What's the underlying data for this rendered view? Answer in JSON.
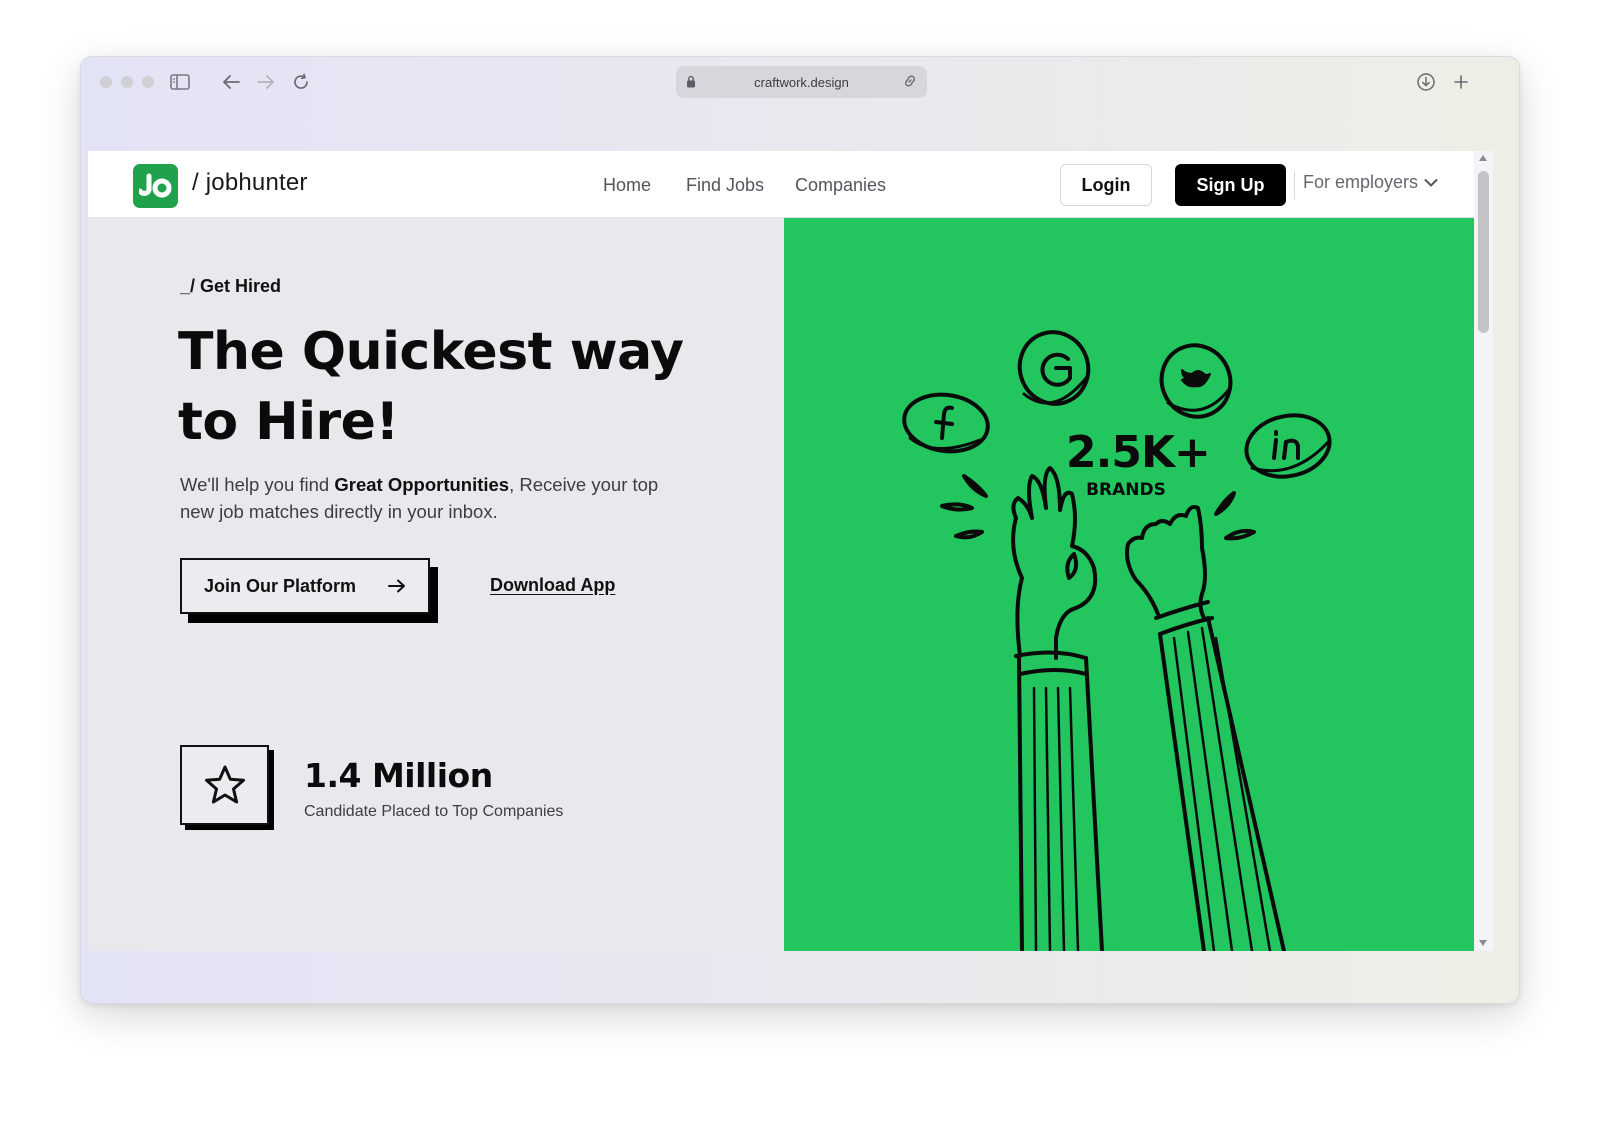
{
  "browser": {
    "url": "craftwork.design"
  },
  "nav": {
    "logo_mark": "Jo",
    "logo_text": "/ jobhunter",
    "links": [
      "Home",
      "Find Jobs",
      "Companies"
    ],
    "login_label": "Login",
    "signup_label": "Sign Up",
    "employers_label": "For employers"
  },
  "hero": {
    "eyebrow": "_/ Get Hired",
    "headline_line1": "The Quickest way",
    "headline_line2": "to Hire!",
    "sub_prefix": "We'll help you find ",
    "sub_bold": "Great Opportunities",
    "sub_suffix": ", Receive your top new job matches directly in your inbox.",
    "cta_label": "Join Our Platform",
    "download_label": "Download App",
    "stat_value": "1.4 Million",
    "stat_label": "Candidate Placed to Top Companies"
  },
  "illustration": {
    "brands_value": "2.5K+",
    "brands_label": "BRANDS",
    "social_icons": [
      "facebook-icon",
      "google-icon",
      "twitter-icon",
      "linkedin-icon"
    ],
    "background_color": "#22c55e"
  },
  "colors": {
    "brand_green": "#1fa24b",
    "accent_black": "#000000"
  }
}
